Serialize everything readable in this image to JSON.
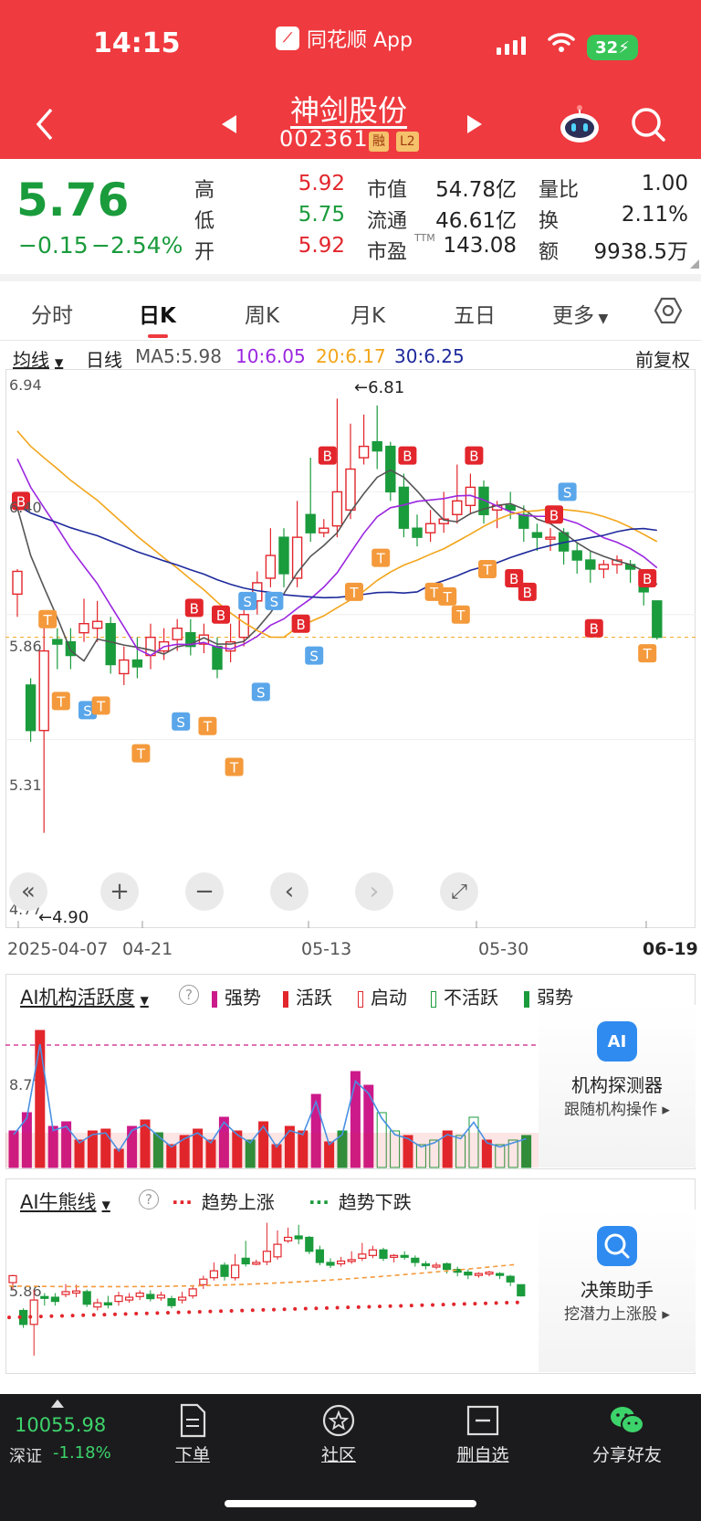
{
  "status_bar": {
    "time": "14:15",
    "app_name": "同花顺 App",
    "battery": "32"
  },
  "header": {
    "stock_name": "神剑股份",
    "stock_code": "002361",
    "tag_margin": "融",
    "tag_level": "L2"
  },
  "quote": {
    "price": "5.76",
    "change": "−0.15",
    "change_pct": "−2.54%",
    "high_label": "高",
    "high": "5.92",
    "low_label": "低",
    "low": "5.75",
    "open_label": "开",
    "open": "5.92",
    "mcap_label": "市值",
    "mcap": "54.78亿",
    "float_label": "流通",
    "float": "46.61亿",
    "pe_label": "市盈",
    "pe_sup": "TTM",
    "pe": "143.08",
    "volratio_label": "量比",
    "volratio": "1.00",
    "turnover_label": "换",
    "turnover": "2.11%",
    "amount_label": "额",
    "amount": "9938.5万"
  },
  "tabs": [
    "分时",
    "日K",
    "周K",
    "月K",
    "五日",
    "更多"
  ],
  "ma_legend": {
    "selector": "均线",
    "period": "日线",
    "ma5": "MA5:5.98",
    "ma10": "10:6.05",
    "ma20": "20:6.17",
    "ma30": "30:6.25",
    "adjust": "前复权"
  },
  "chart": {
    "y_top": "6.94",
    "y_mid1": "6.40",
    "y_mid2": "5.86",
    "y_mid3": "5.31",
    "y_bottom": "4.77",
    "high_note": "←6.81",
    "low_note": "←4.90",
    "dates": [
      "2025-04-07",
      "04-21",
      "05-13",
      "05-30",
      "06-19"
    ]
  },
  "controls": [
    "«",
    "+",
    "−",
    "‹",
    "›",
    "⤢"
  ],
  "colors": {
    "up": "#e2262c",
    "down": "#1a9b3c",
    "ma5": "#555555",
    "ma10": "#9b27e0",
    "ma20": "#f2a51a",
    "ma30": "#1e2a9c",
    "brand": "#ef3a3f"
  },
  "panel1": {
    "title": "AI机构活跃度",
    "legend": [
      "强势",
      "活跃",
      "启动",
      "不活跃",
      "弱势"
    ],
    "level": "8.77",
    "side_title": "机构探测器",
    "side_sub": "跟随机构操作 ▸",
    "side_icon": "AI"
  },
  "panel2": {
    "title": "AI牛熊线",
    "legend_up": "趋势上涨",
    "legend_down": "趋势下跌",
    "level": "5.86",
    "side_title": "决策助手",
    "side_sub": "挖潜力上涨股 ▸"
  },
  "bottom_bar": {
    "index_value": "10055.98",
    "index_name": "深证",
    "index_change": "-1.18%",
    "items": [
      "下单",
      "社区",
      "删自选",
      "分享好友"
    ]
  }
}
